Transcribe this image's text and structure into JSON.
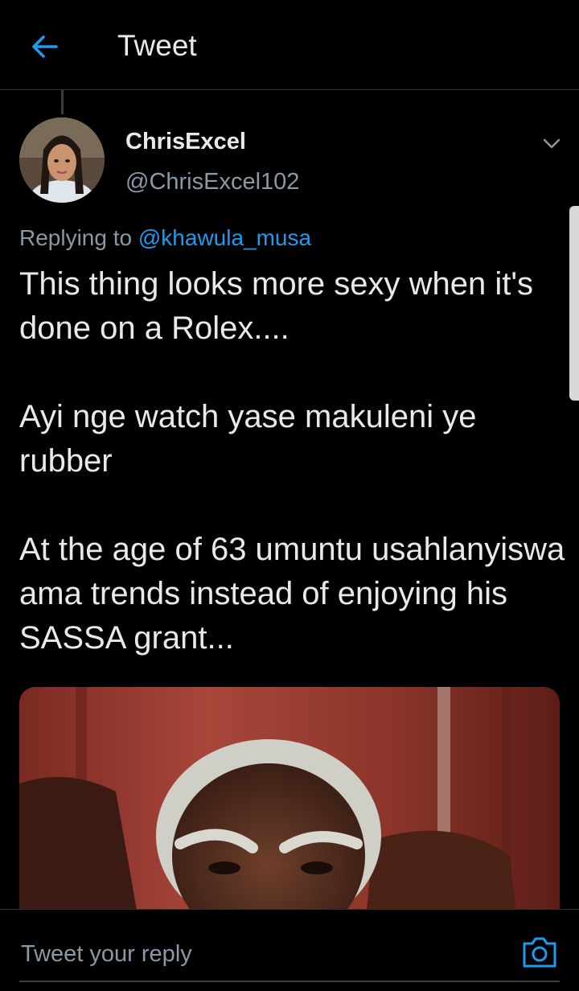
{
  "header": {
    "title": "Tweet",
    "back_icon": "arrow-left-icon"
  },
  "tweet": {
    "author_name": "ChrisExcel",
    "author_handle": "@ChrisExcel102",
    "replying_prefix": "Replying to",
    "replying_to": "@khawula_musa",
    "paragraphs": [
      "This thing looks more sexy when it's done on a Rolex....",
      "Ayi nge watch yase makuleni ye rubber",
      "At the age of 63 umuntu usahlanyiswa ama trends instead of enjoying his SASSA grant..."
    ],
    "more_icon": "chevron-down-icon"
  },
  "reply_bar": {
    "placeholder": "Tweet your reply",
    "camera_icon": "camera-icon"
  },
  "colors": {
    "accent": "#1d9bf0",
    "background": "#000000",
    "muted": "#8b98a5"
  }
}
